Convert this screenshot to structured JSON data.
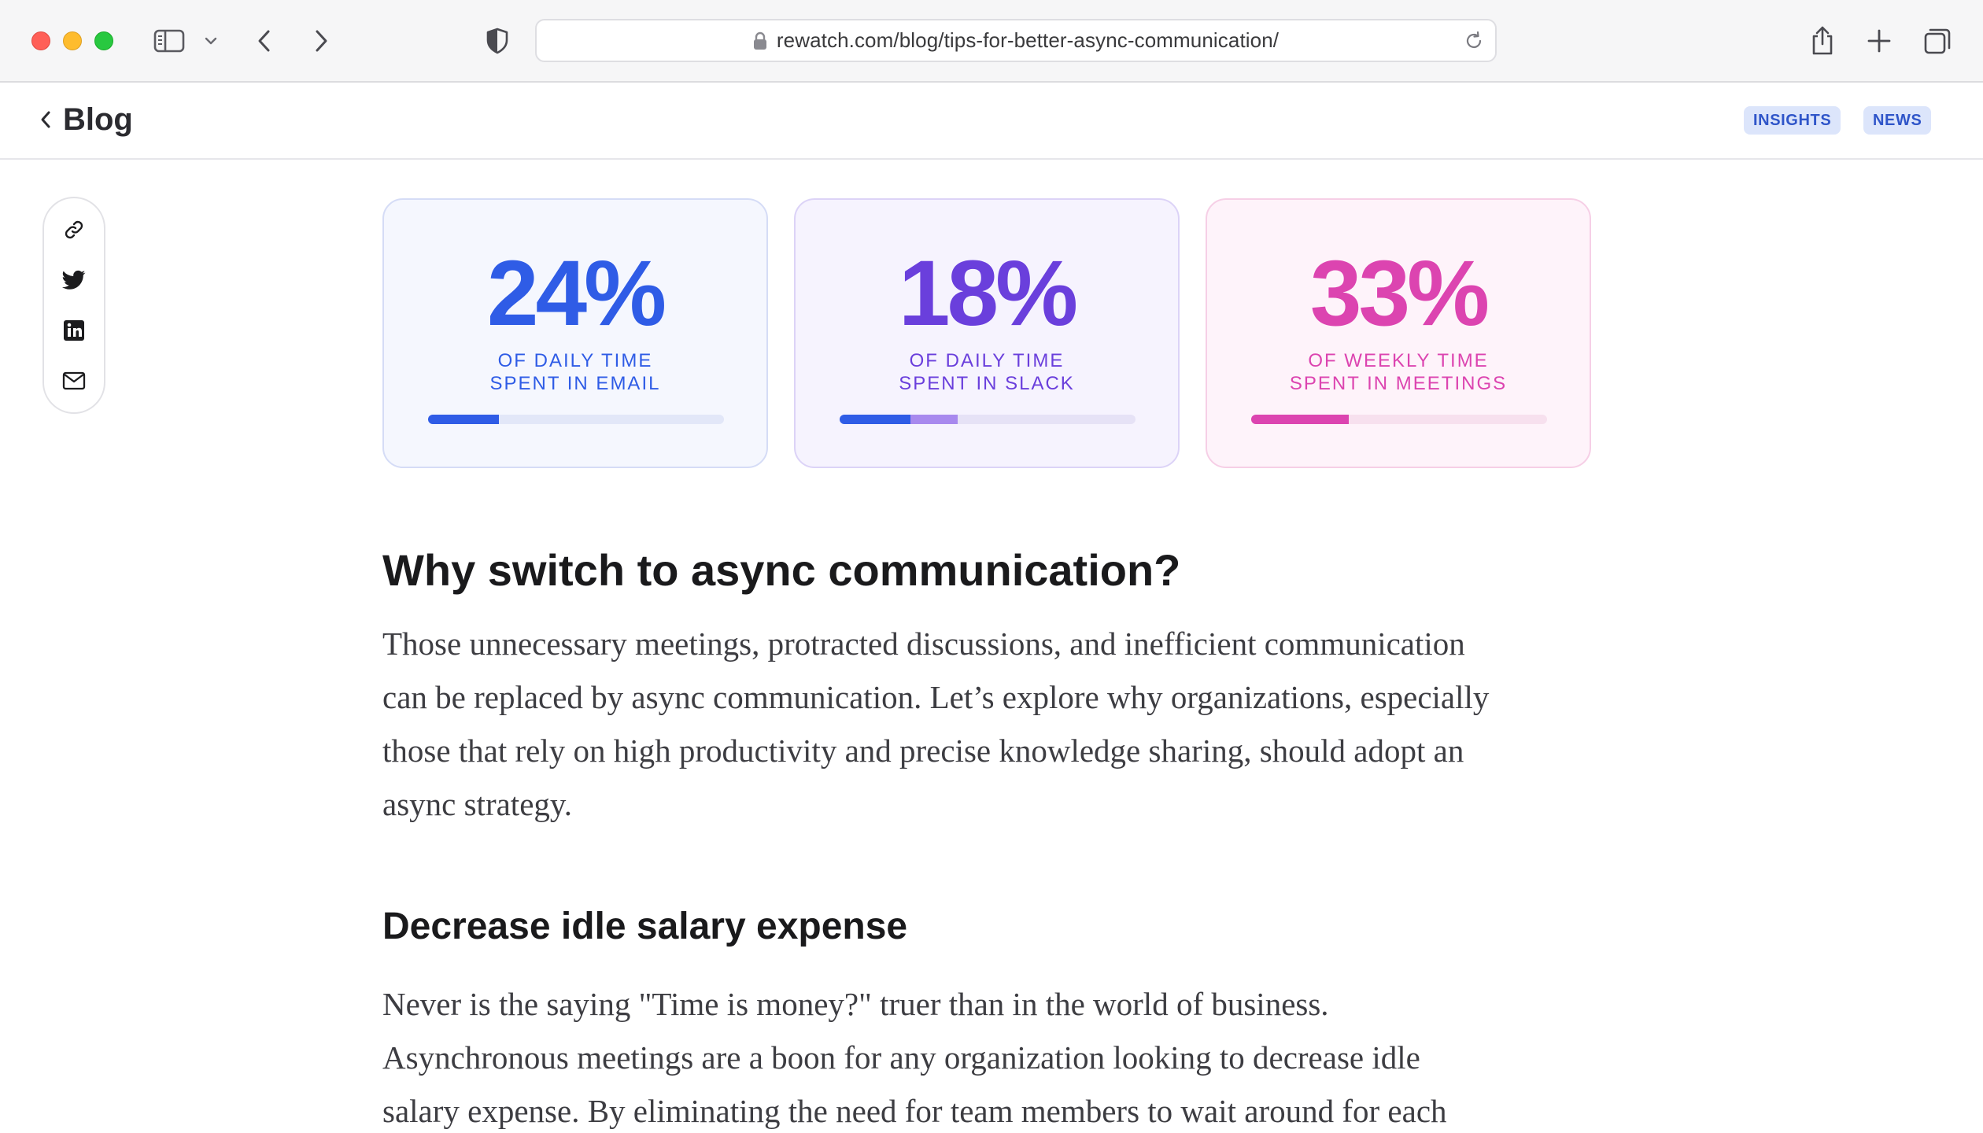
{
  "browser": {
    "url": "rewatch.com/blog/tips-for-better-async-communication/"
  },
  "header": {
    "back_label": "Blog",
    "tags": [
      "INSIGHTS",
      "NEWS"
    ]
  },
  "share": {
    "icons": [
      "link-icon",
      "twitter-icon",
      "linkedin-icon",
      "email-icon"
    ]
  },
  "stats": [
    {
      "value": "24%",
      "caption_line1": "OF DAILY TIME",
      "caption_line2": "SPENT IN EMAIL",
      "color": "#2f5ce6",
      "segments": [
        {
          "fraction": 0.24,
          "color": "#2f5ce6"
        }
      ]
    },
    {
      "value": "18%",
      "caption_line1": "OF DAILY TIME",
      "caption_line2": "SPENT IN SLACK",
      "color": "#6a3fdc",
      "segments": [
        {
          "fraction": 0.24,
          "color": "#2f5ce6"
        },
        {
          "fraction": 0.16,
          "color": "#a889ee"
        }
      ]
    },
    {
      "value": "33%",
      "caption_line1": "OF WEEKLY TIME",
      "caption_line2": "SPENT IN MEETINGS",
      "color": "#dc44b0",
      "segments": [
        {
          "fraction": 0.33,
          "color": "#dc44b0"
        }
      ]
    }
  ],
  "article": {
    "heading": "Why switch to async communication?",
    "intro_lines": [
      "Those unnecessary meetings, protracted discussions, and inefficient communication",
      "can be replaced by async communication. Let’s explore why organizations, especially",
      "those that rely on high productivity and precise knowledge sharing, should adopt an",
      "async strategy."
    ],
    "subheading": "Decrease idle salary expense",
    "body_lines": [
      "Never is the saying \"Time is money?\" truer than in the world of business.",
      "Asynchronous meetings are a boon for any organization looking to decrease idle",
      "salary expense. By eliminating the need for team members to wait around for each"
    ]
  }
}
